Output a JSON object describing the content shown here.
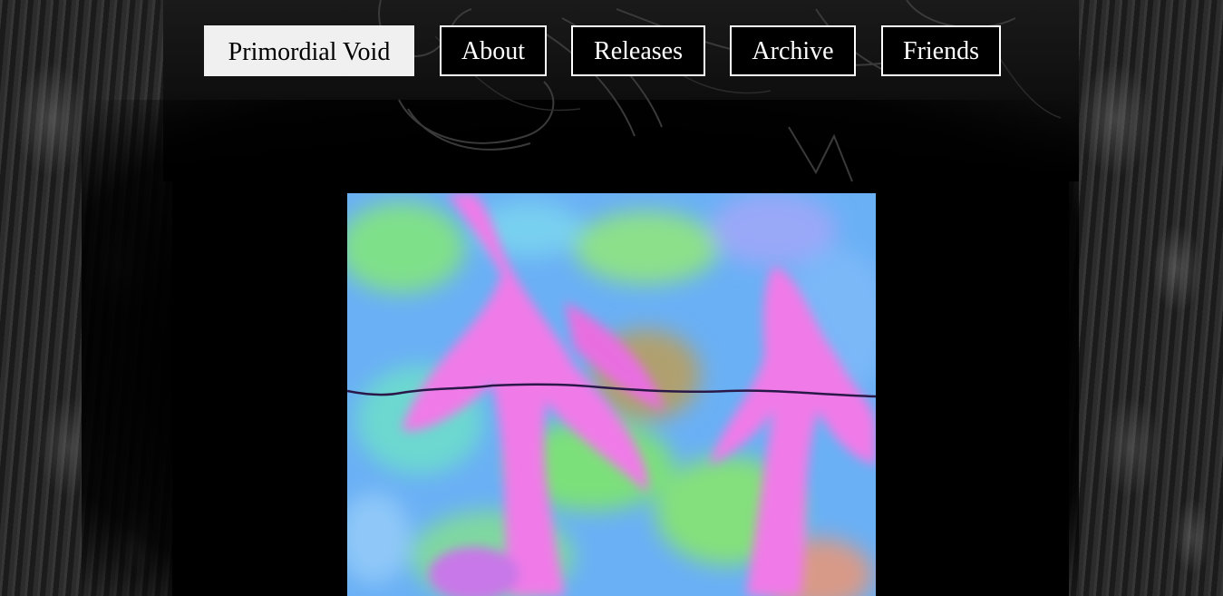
{
  "site": {
    "title": "Primordial Void"
  },
  "nav": {
    "items": [
      {
        "label": "Primordial Void",
        "active": true
      },
      {
        "label": "About",
        "active": false
      },
      {
        "label": "Releases",
        "active": false
      },
      {
        "label": "Archive",
        "active": false
      },
      {
        "label": "Friends",
        "active": false
      }
    ]
  },
  "colors": {
    "background": "#000000",
    "nav_border": "#ffffff",
    "nav_text": "#ffffff",
    "active_bg": "#f0f0f0",
    "active_text": "#000000",
    "art_pink": "#f07ae8",
    "art_blue": "#6ab0f5",
    "art_green": "#78e07a"
  }
}
